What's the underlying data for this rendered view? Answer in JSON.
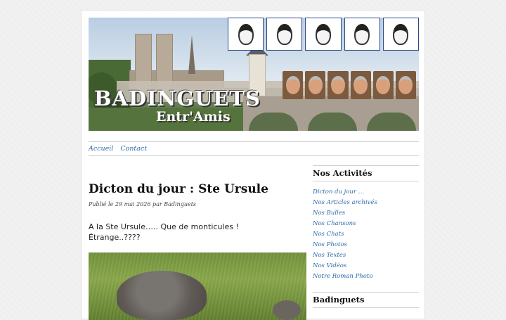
{
  "site": {
    "title": "BADINGUETS",
    "subtitle": "Entr'Amis"
  },
  "nav": [
    {
      "label": "Accueil"
    },
    {
      "label": "Contact"
    }
  ],
  "post": {
    "title": "Dicton du jour : Ste Ursule",
    "meta": "Publié le 29 mai 2026 par Badinguets",
    "line1": "A la Ste Ursule….. Que de monticules !",
    "line2": "Étrange..????"
  },
  "sidebar": {
    "activities_title": "Nos Activités",
    "activities": [
      "Dicton du jour …",
      "Nos Articles archivés",
      "Nos Bulles",
      "Nos Chansons",
      "Nos Chats",
      "Nos Photos",
      "Nos Textes",
      "Nos Vidéos",
      "Notre Roman Photo"
    ],
    "second_title": "Badinguets"
  },
  "colors": {
    "link": "#2b6aa8",
    "background": "#f1f1f1"
  }
}
